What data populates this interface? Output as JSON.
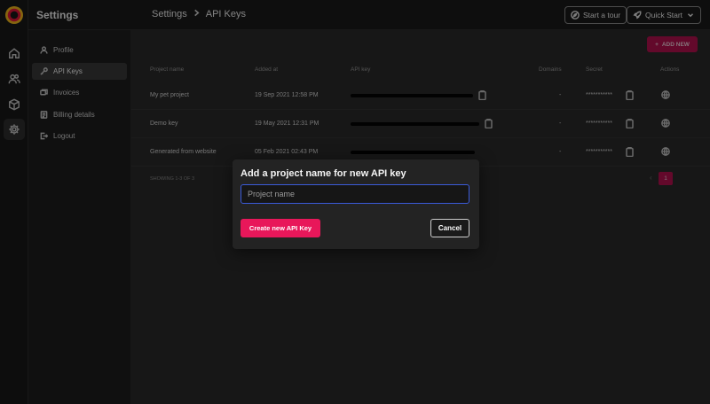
{
  "app": {
    "title": "Settings"
  },
  "breadcrumb": {
    "parent": "Settings",
    "current": "API Keys"
  },
  "header": {
    "tour_label": "Start a tour",
    "quick_start_label": "Quick Start"
  },
  "rail": {
    "items": [
      "home-icon",
      "users-icon",
      "cube-icon",
      "gear-icon"
    ],
    "active": "gear-icon"
  },
  "sidebar": {
    "items": [
      {
        "label": "Profile",
        "icon": "person-icon"
      },
      {
        "label": "API Keys",
        "icon": "key-icon",
        "active": true
      },
      {
        "label": "Invoices",
        "icon": "invoices-icon"
      },
      {
        "label": "Billing details",
        "icon": "billing-icon"
      },
      {
        "label": "Logout",
        "icon": "logout-icon"
      }
    ]
  },
  "table": {
    "add_new_label": "ADD NEW",
    "columns": [
      "Project name",
      "Added at",
      "API key",
      "Domains",
      "Secret",
      "Actions"
    ],
    "rows": [
      {
        "name": "My pet project",
        "added": "19 Sep 2021 12:58 PM",
        "domains": "-",
        "secret": "***********"
      },
      {
        "name": "Demo key",
        "added": "19 May 2021 12:31 PM",
        "domains": "-",
        "secret": "***********"
      },
      {
        "name": "Generated from website",
        "added": "05 Feb 2021 02:43 PM",
        "domains": "-",
        "secret": "***********"
      }
    ],
    "footer": "SHOWING 1-3 OF 3",
    "page": "1"
  },
  "modal": {
    "title": "Add a project name for new API key",
    "input_placeholder": "Project name",
    "input_value": "",
    "create_label": "Create new API Key",
    "cancel_label": "Cancel"
  },
  "colors": {
    "accent": "#e8175a",
    "focus": "#3b5bd9",
    "background": "#1e1e1e"
  }
}
